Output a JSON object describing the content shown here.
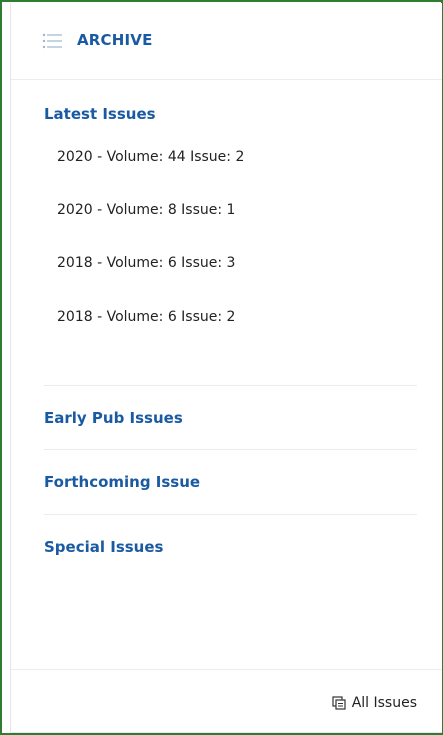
{
  "header": {
    "icon": "list-icon",
    "title": "ARCHIVE"
  },
  "latest": {
    "title": "Latest Issues",
    "items": [
      {
        "label": "2020 - Volume: 44 Issue: 2"
      },
      {
        "label": "2020 - Volume: 8 Issue: 1"
      },
      {
        "label": "2018 - Volume: 6 Issue: 3"
      },
      {
        "label": "2018 - Volume: 6 Issue: 2"
      }
    ]
  },
  "sections": {
    "early": "Early Pub Issues",
    "forthcoming": "Forthcoming Issue",
    "special": "Special Issues"
  },
  "footer": {
    "icon": "copy-icon",
    "all_issues": "All Issues"
  },
  "colors": {
    "accent": "#1a5aa3",
    "border": "#2e7d32"
  }
}
